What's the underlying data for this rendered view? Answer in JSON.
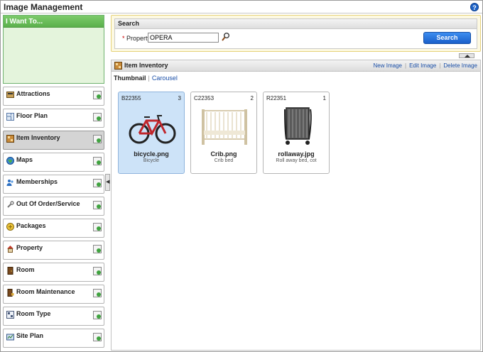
{
  "app": {
    "title": "Image Management",
    "help_icon": "help-icon"
  },
  "sidebar": {
    "header": "I Want To...",
    "items": [
      {
        "label": "Attractions",
        "icon": "attractions-icon",
        "active": false
      },
      {
        "label": "Floor Plan",
        "icon": "floor-plan-icon",
        "active": false
      },
      {
        "label": "Item Inventory",
        "icon": "item-inventory-icon",
        "active": true
      },
      {
        "label": "Maps",
        "icon": "globe-icon",
        "active": false
      },
      {
        "label": "Memberships",
        "icon": "people-icon",
        "active": false
      },
      {
        "label": "Out Of Order/Service",
        "icon": "wrench-icon",
        "active": false
      },
      {
        "label": "Packages",
        "icon": "package-icon",
        "active": false
      },
      {
        "label": "Property",
        "icon": "house-icon",
        "active": false
      },
      {
        "label": "Room",
        "icon": "door-icon",
        "active": false
      },
      {
        "label": "Room Maintenance",
        "icon": "door-maintenance-icon",
        "active": false
      },
      {
        "label": "Room Type",
        "icon": "room-type-icon",
        "active": false
      },
      {
        "label": "Site Plan",
        "icon": "site-plan-icon",
        "active": false
      }
    ]
  },
  "search": {
    "header": "Search",
    "required_marker": "*",
    "property_label": "Property",
    "property_value": "OPERA",
    "button": "Search"
  },
  "inventory": {
    "title": "Item Inventory",
    "actions": [
      "New Image",
      "Edit Image",
      "Delete Image"
    ],
    "view_tabs": {
      "active": "Thumbnail",
      "other": "Carousel"
    },
    "cards": [
      {
        "code": "B22355",
        "count": "3",
        "filename": "bicycle.png",
        "description": "Bicycle",
        "selected": true,
        "image": "bicycle-image"
      },
      {
        "code": "C22353",
        "count": "2",
        "filename": "Crib.png",
        "description": "Crib bed",
        "selected": false,
        "image": "crib-image"
      },
      {
        "code": "R22351",
        "count": "1",
        "filename": "rollaway.jpg",
        "description": "Roll away bed, cot",
        "selected": false,
        "image": "rollaway-bed-image"
      }
    ]
  },
  "colors": {
    "accent_blue": "#1a5fca",
    "sidebar_green": "#5bb04c",
    "selected_card": "#cde3f8"
  }
}
